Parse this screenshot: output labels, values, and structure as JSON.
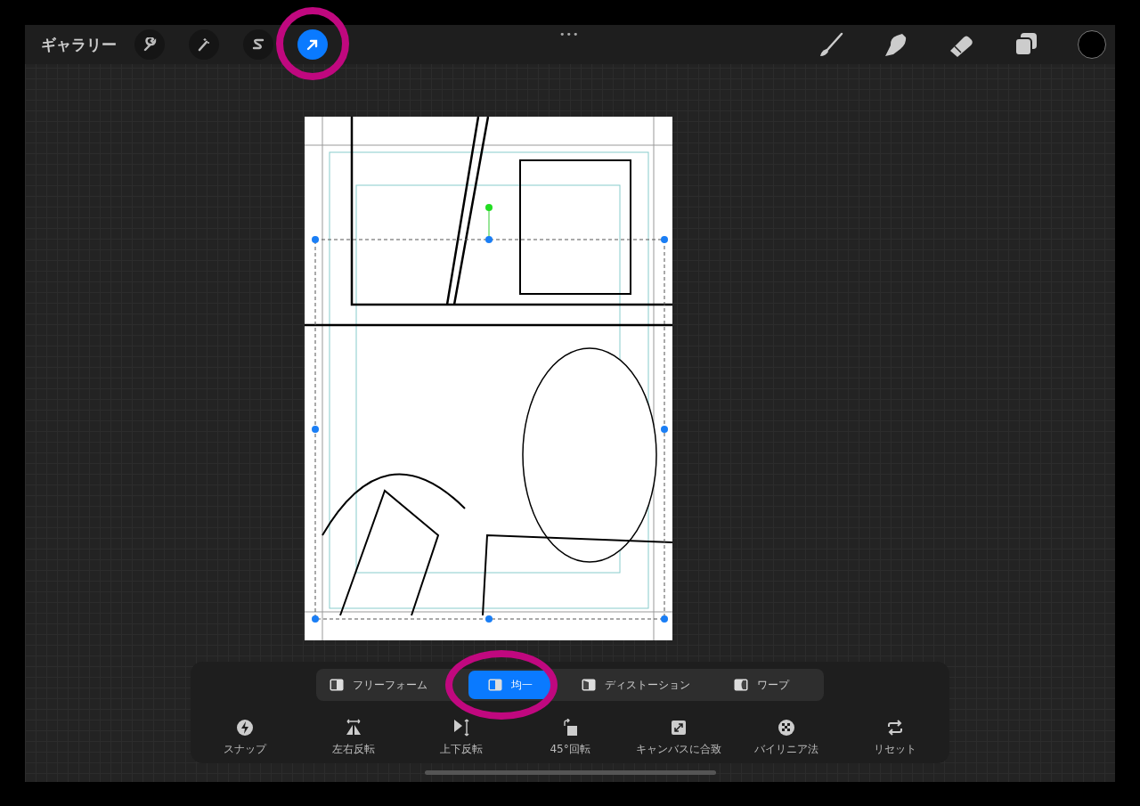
{
  "top_bar": {
    "gallery": "ギャラリー",
    "tools": [
      {
        "selected": false
      },
      {
        "selected": false
      },
      {
        "selected": false
      },
      {
        "selected": true
      }
    ],
    "more": "•••",
    "color": "#000000"
  },
  "transform_modes": [
    {
      "label": "フリーフォーム",
      "selected": false
    },
    {
      "label": "均一",
      "selected": true
    },
    {
      "label": "ディストーション",
      "selected": false
    },
    {
      "label": "ワープ",
      "selected": false
    }
  ],
  "actions": [
    {
      "label": "スナップ"
    },
    {
      "label": "左右反転"
    },
    {
      "label": "上下反転"
    },
    {
      "label": "45°回転"
    },
    {
      "label": "キャンバスに合致"
    },
    {
      "label": "バイリニア法"
    },
    {
      "label": "リセット"
    }
  ]
}
